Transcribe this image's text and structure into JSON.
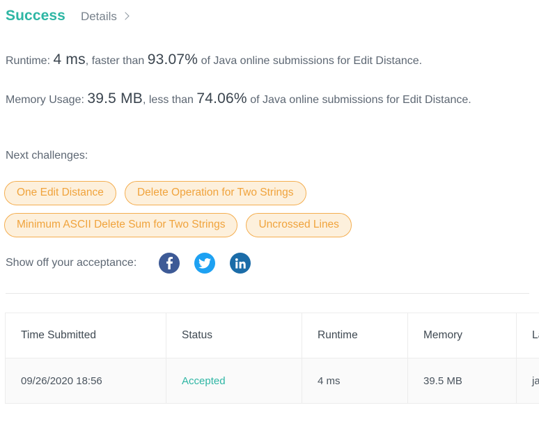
{
  "header": {
    "status_title": "Success",
    "details_label": "Details",
    "details_chevron_icon": "chevron-right-icon"
  },
  "runtime_stat": {
    "prefix": "Runtime:",
    "value": "4 ms",
    "middle": ", faster than",
    "percentile": "93.07%",
    "suffix": "of Java online submissions for Edit Distance."
  },
  "memory_stat": {
    "prefix": "Memory Usage:",
    "value": "39.5 MB",
    "middle": ", less than",
    "percentile": "74.06%",
    "suffix": "of Java online submissions for Edit Distance."
  },
  "next_challenges": {
    "label": "Next challenges:",
    "items": [
      {
        "label": "One Edit Distance"
      },
      {
        "label": "Delete Operation for Two Strings"
      },
      {
        "label": "Minimum ASCII Delete Sum for Two Strings"
      },
      {
        "label": "Uncrossed Lines"
      }
    ]
  },
  "share": {
    "label": "Show off your acceptance:",
    "buttons": [
      {
        "name": "facebook-icon",
        "color": "#3d5a96"
      },
      {
        "name": "twitter-icon",
        "color": "#1da1f2"
      },
      {
        "name": "linkedin-icon",
        "color": "#1b6ca8"
      }
    ]
  },
  "submissions_table": {
    "columns": [
      "Time Submitted",
      "Status",
      "Runtime",
      "Memory",
      "Language"
    ],
    "rows": [
      {
        "time_submitted": "09/26/2020 18:56",
        "status": "Accepted",
        "runtime": "4 ms",
        "memory": "39.5 MB",
        "language": "java"
      }
    ]
  },
  "colors": {
    "success_teal": "#2eb6a4",
    "pill_border": "#f4ae50",
    "pill_background": "#fdf0dc",
    "pill_text": "#f0a33c",
    "body_text": "#5d6773"
  }
}
